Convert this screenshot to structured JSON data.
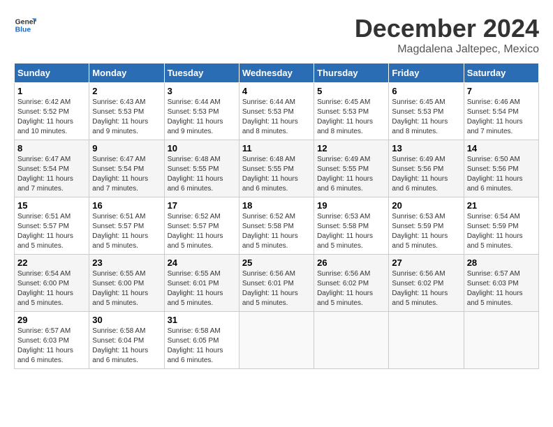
{
  "logo": {
    "line1": "General",
    "line2": "Blue"
  },
  "title": "December 2024",
  "location": "Magdalena Jaltepec, Mexico",
  "days_of_week": [
    "Sunday",
    "Monday",
    "Tuesday",
    "Wednesday",
    "Thursday",
    "Friday",
    "Saturday"
  ],
  "weeks": [
    [
      {
        "day": "1",
        "sunrise": "6:42 AM",
        "sunset": "5:52 PM",
        "daylight": "11 hours and 10 minutes."
      },
      {
        "day": "2",
        "sunrise": "6:43 AM",
        "sunset": "5:53 PM",
        "daylight": "11 hours and 9 minutes."
      },
      {
        "day": "3",
        "sunrise": "6:44 AM",
        "sunset": "5:53 PM",
        "daylight": "11 hours and 9 minutes."
      },
      {
        "day": "4",
        "sunrise": "6:44 AM",
        "sunset": "5:53 PM",
        "daylight": "11 hours and 8 minutes."
      },
      {
        "day": "5",
        "sunrise": "6:45 AM",
        "sunset": "5:53 PM",
        "daylight": "11 hours and 8 minutes."
      },
      {
        "day": "6",
        "sunrise": "6:45 AM",
        "sunset": "5:53 PM",
        "daylight": "11 hours and 8 minutes."
      },
      {
        "day": "7",
        "sunrise": "6:46 AM",
        "sunset": "5:54 PM",
        "daylight": "11 hours and 7 minutes."
      }
    ],
    [
      {
        "day": "8",
        "sunrise": "6:47 AM",
        "sunset": "5:54 PM",
        "daylight": "11 hours and 7 minutes."
      },
      {
        "day": "9",
        "sunrise": "6:47 AM",
        "sunset": "5:54 PM",
        "daylight": "11 hours and 7 minutes."
      },
      {
        "day": "10",
        "sunrise": "6:48 AM",
        "sunset": "5:55 PM",
        "daylight": "11 hours and 6 minutes."
      },
      {
        "day": "11",
        "sunrise": "6:48 AM",
        "sunset": "5:55 PM",
        "daylight": "11 hours and 6 minutes."
      },
      {
        "day": "12",
        "sunrise": "6:49 AM",
        "sunset": "5:55 PM",
        "daylight": "11 hours and 6 minutes."
      },
      {
        "day": "13",
        "sunrise": "6:49 AM",
        "sunset": "5:56 PM",
        "daylight": "11 hours and 6 minutes."
      },
      {
        "day": "14",
        "sunrise": "6:50 AM",
        "sunset": "5:56 PM",
        "daylight": "11 hours and 6 minutes."
      }
    ],
    [
      {
        "day": "15",
        "sunrise": "6:51 AM",
        "sunset": "5:57 PM",
        "daylight": "11 hours and 5 minutes."
      },
      {
        "day": "16",
        "sunrise": "6:51 AM",
        "sunset": "5:57 PM",
        "daylight": "11 hours and 5 minutes."
      },
      {
        "day": "17",
        "sunrise": "6:52 AM",
        "sunset": "5:57 PM",
        "daylight": "11 hours and 5 minutes."
      },
      {
        "day": "18",
        "sunrise": "6:52 AM",
        "sunset": "5:58 PM",
        "daylight": "11 hours and 5 minutes."
      },
      {
        "day": "19",
        "sunrise": "6:53 AM",
        "sunset": "5:58 PM",
        "daylight": "11 hours and 5 minutes."
      },
      {
        "day": "20",
        "sunrise": "6:53 AM",
        "sunset": "5:59 PM",
        "daylight": "11 hours and 5 minutes."
      },
      {
        "day": "21",
        "sunrise": "6:54 AM",
        "sunset": "5:59 PM",
        "daylight": "11 hours and 5 minutes."
      }
    ],
    [
      {
        "day": "22",
        "sunrise": "6:54 AM",
        "sunset": "6:00 PM",
        "daylight": "11 hours and 5 minutes."
      },
      {
        "day": "23",
        "sunrise": "6:55 AM",
        "sunset": "6:00 PM",
        "daylight": "11 hours and 5 minutes."
      },
      {
        "day": "24",
        "sunrise": "6:55 AM",
        "sunset": "6:01 PM",
        "daylight": "11 hours and 5 minutes."
      },
      {
        "day": "25",
        "sunrise": "6:56 AM",
        "sunset": "6:01 PM",
        "daylight": "11 hours and 5 minutes."
      },
      {
        "day": "26",
        "sunrise": "6:56 AM",
        "sunset": "6:02 PM",
        "daylight": "11 hours and 5 minutes."
      },
      {
        "day": "27",
        "sunrise": "6:56 AM",
        "sunset": "6:02 PM",
        "daylight": "11 hours and 5 minutes."
      },
      {
        "day": "28",
        "sunrise": "6:57 AM",
        "sunset": "6:03 PM",
        "daylight": "11 hours and 5 minutes."
      }
    ],
    [
      {
        "day": "29",
        "sunrise": "6:57 AM",
        "sunset": "6:03 PM",
        "daylight": "11 hours and 6 minutes."
      },
      {
        "day": "30",
        "sunrise": "6:58 AM",
        "sunset": "6:04 PM",
        "daylight": "11 hours and 6 minutes."
      },
      {
        "day": "31",
        "sunrise": "6:58 AM",
        "sunset": "6:05 PM",
        "daylight": "11 hours and 6 minutes."
      },
      null,
      null,
      null,
      null
    ]
  ]
}
